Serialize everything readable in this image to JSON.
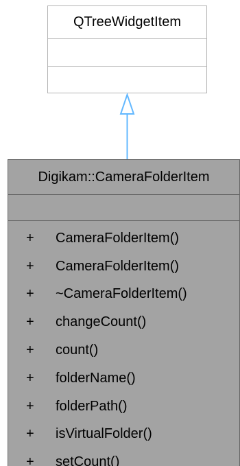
{
  "base_class": {
    "name": "QTreeWidgetItem"
  },
  "derived_class": {
    "name": "Digikam::CameraFolderItem",
    "methods": [
      {
        "visibility": "+",
        "name": "CameraFolderItem()"
      },
      {
        "visibility": "+",
        "name": "CameraFolderItem()"
      },
      {
        "visibility": "+",
        "name": "~CameraFolderItem()"
      },
      {
        "visibility": "+",
        "name": "changeCount()"
      },
      {
        "visibility": "+",
        "name": "count()"
      },
      {
        "visibility": "+",
        "name": "folderName()"
      },
      {
        "visibility": "+",
        "name": "folderPath()"
      },
      {
        "visibility": "+",
        "name": "isVirtualFolder()"
      },
      {
        "visibility": "+",
        "name": "setCount()"
      }
    ]
  },
  "relationship": {
    "type": "inheritance",
    "color": "#63b8ff"
  }
}
